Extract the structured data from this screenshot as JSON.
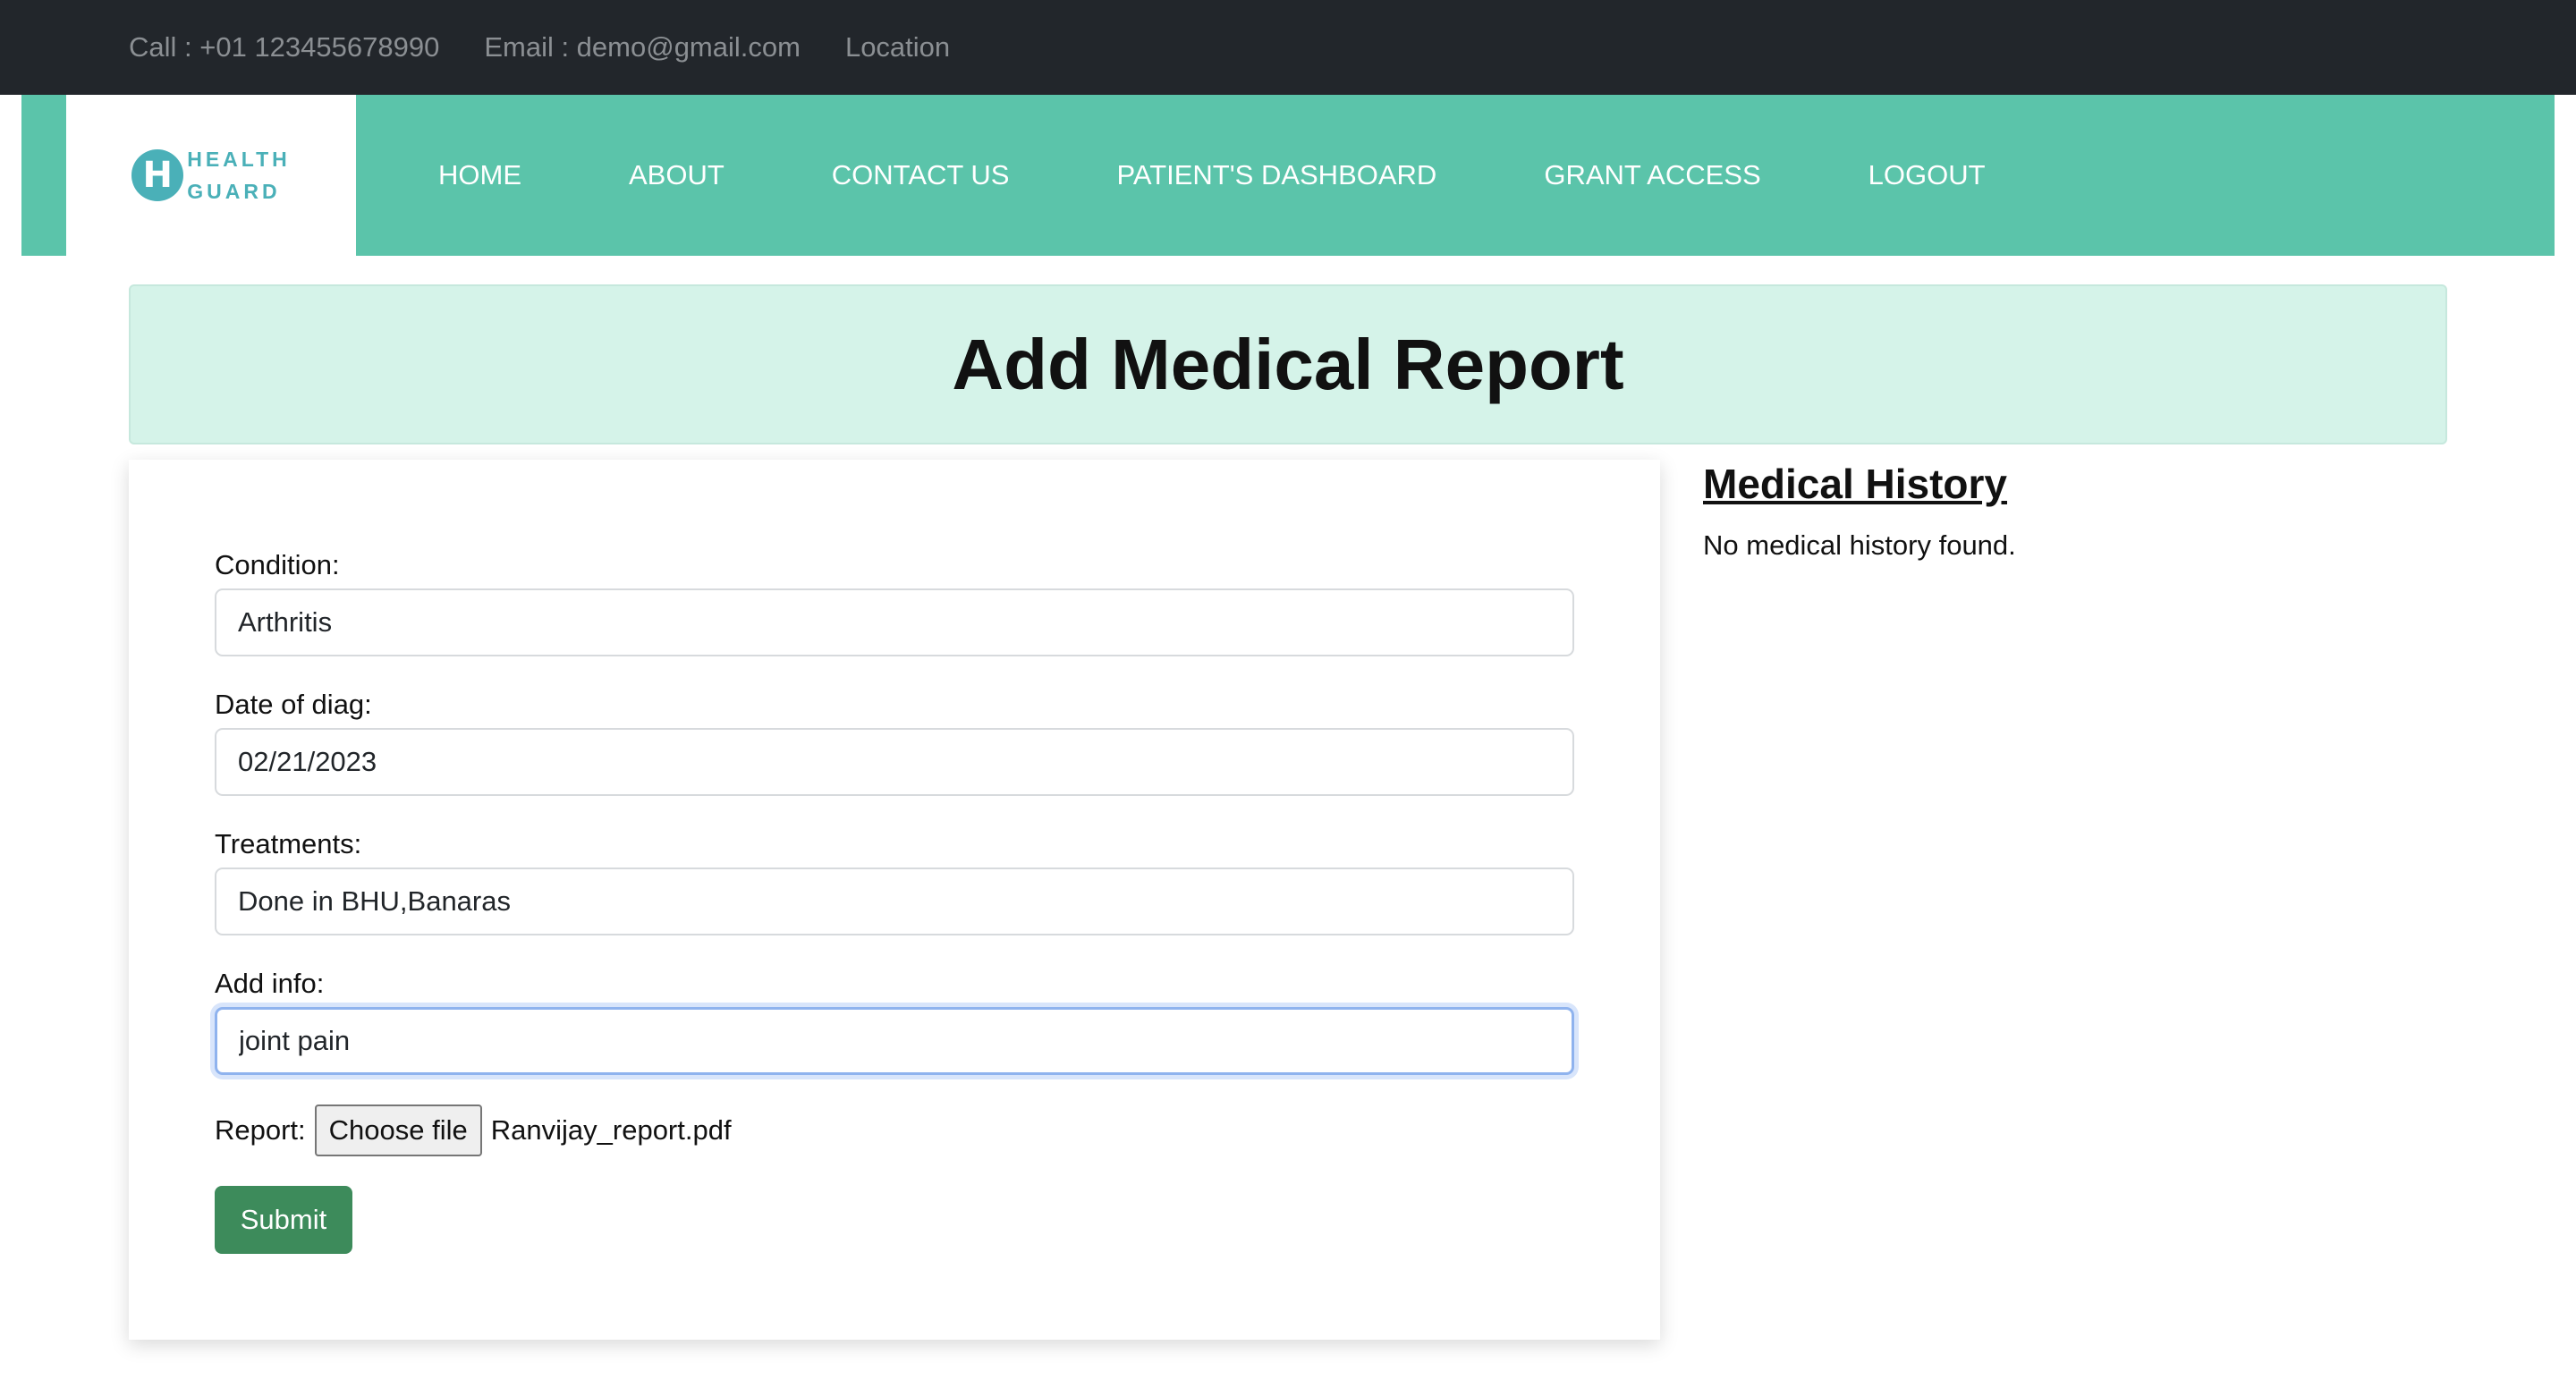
{
  "topbar": {
    "call": "Call : +01 123455678990",
    "email": "Email : demo@gmail.com",
    "location": "Location"
  },
  "logo": {
    "letter": "H",
    "line1": "HEALTH",
    "line2": "GUARD"
  },
  "nav": {
    "items": [
      "HOME",
      "ABOUT",
      "CONTACT US",
      "PATIENT'S DASHBOARD",
      "GRANT ACCESS",
      "LOGOUT"
    ]
  },
  "page": {
    "title": "Add Medical Report"
  },
  "form": {
    "condition_label": "Condition:",
    "condition_value": "Arthritis",
    "date_label": "Date of diag:",
    "date_value": "02/21/2023",
    "treatments_label": "Treatments:",
    "treatments_value": "Done in BHU,Banaras",
    "info_label": "Add info:",
    "info_value": "joint pain",
    "report_label": "Report:",
    "file_button": "Choose file",
    "file_name": "Ranvijay_report.pdf",
    "submit": "Submit"
  },
  "history": {
    "title": "Medical History",
    "empty": "No medical history found."
  },
  "colors": {
    "topbar": "#22262b",
    "nav": "#5bc4aa",
    "banner": "#d5f3e9",
    "submit": "#3d8b5b",
    "logo": "#4ab0b8"
  }
}
